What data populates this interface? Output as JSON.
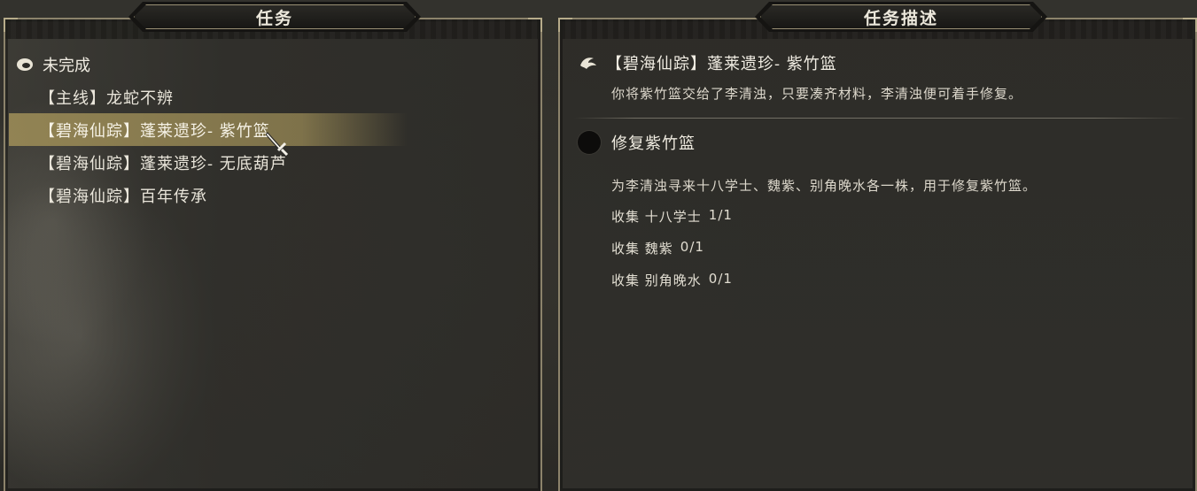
{
  "tabs": {
    "quests_title": "任务",
    "description_title": "任务描述"
  },
  "quest_list": {
    "section_label": "未完成",
    "items": [
      {
        "label": "【主线】龙蛇不辨",
        "selected": false
      },
      {
        "label": "【碧海仙踪】蓬莱遗珍- 紫竹篮",
        "selected": true
      },
      {
        "label": "【碧海仙踪】蓬莱遗珍- 无底葫芦",
        "selected": false
      },
      {
        "label": "【碧海仙踪】百年传承",
        "selected": false
      }
    ]
  },
  "detail": {
    "quest_title": "【碧海仙踪】蓬莱遗珍- 紫竹篮",
    "quest_description": "你将紫竹篮交给了李清浊，只要凑齐材料，李清浊便可着手修复。",
    "task_title": "修复紫竹篮",
    "task_description": "为李清浊寻来十八学士、魏紫、别角晚水各一株，用于修复紫竹篮。",
    "objectives": [
      {
        "name": "收集 十八学士",
        "progress": "1/1"
      },
      {
        "name": "收集 魏紫",
        "progress": "0/1"
      },
      {
        "name": "收集 别角晚水",
        "progress": "0/1"
      }
    ]
  },
  "icons": {
    "section": "cloud-icon",
    "quest": "crane-icon",
    "task": "dot-icon",
    "cursor": "sword-cursor-icon"
  },
  "colors": {
    "selection": "#968755",
    "frame": "#8c836b",
    "text": "#e6e2d6"
  }
}
